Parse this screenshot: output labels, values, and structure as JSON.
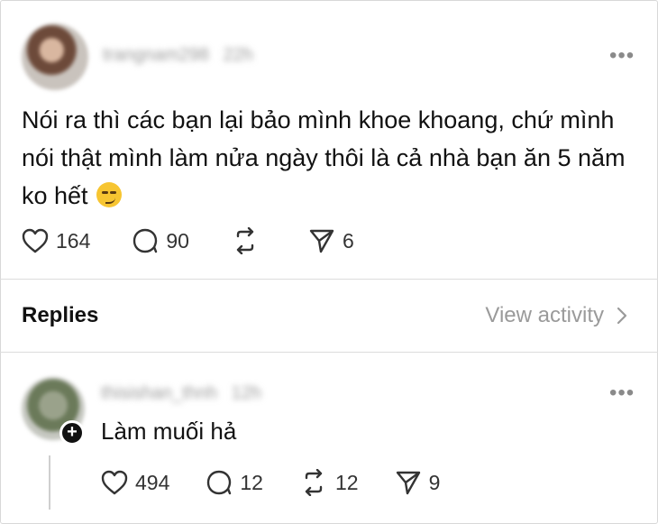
{
  "post": {
    "author": "trangnam298",
    "time": "22h",
    "more": "•••",
    "text": "Nói ra thì các bạn lại bảo mình khoe khoang, chứ mình nói thật mình làm nửa ngày thôi là cả nhà bạn ăn 5 năm ko hết",
    "emoji": "smirk",
    "stats": {
      "likes": "164",
      "comments": "90",
      "shares": "6"
    }
  },
  "replies_header": {
    "label": "Replies",
    "view_activity": "View activity"
  },
  "reply": {
    "author": "thisishan_thnh",
    "time": "12h",
    "more": "•••",
    "text": "Làm muối hả",
    "plus": "+",
    "stats": {
      "likes": "494",
      "comments": "12",
      "reposts": "12",
      "shares": "9"
    }
  },
  "colors": {
    "text": "#111111",
    "muted": "#9a9a9a",
    "divider": "#dcdcdc"
  }
}
